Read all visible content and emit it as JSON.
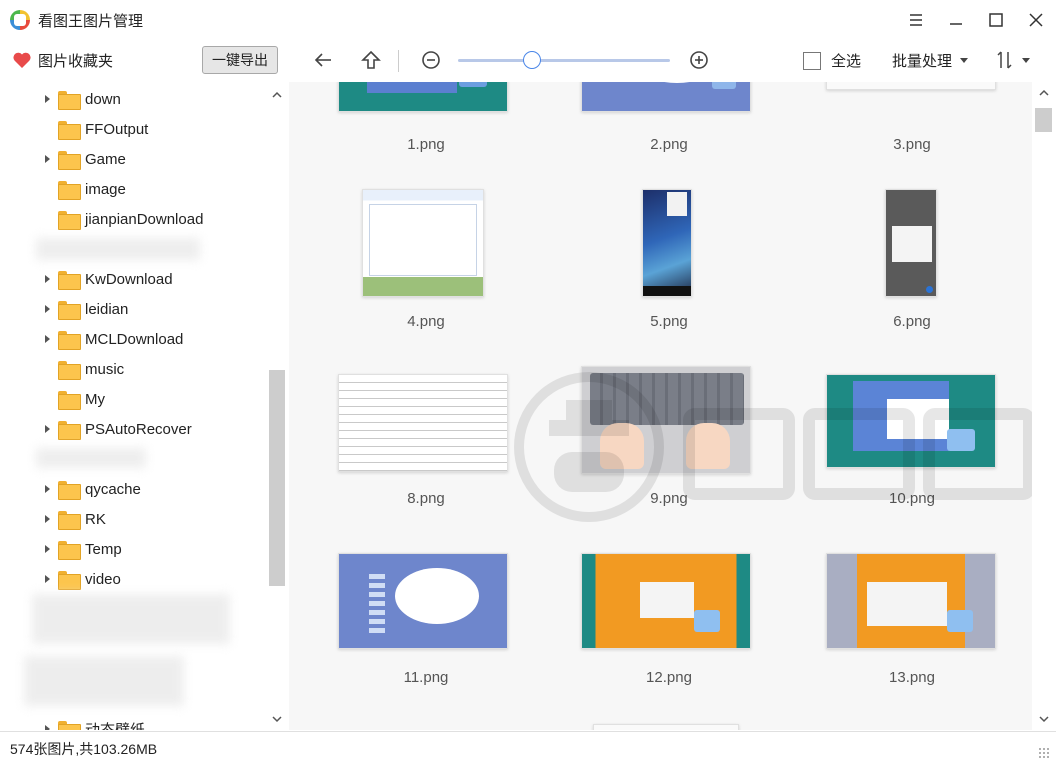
{
  "app": {
    "title": "看图王图片管理",
    "icon": "app-logo-icon"
  },
  "toolbar": {
    "favorites_label": "图片收藏夹",
    "export_label": "一键导出",
    "select_all_label": "全选",
    "batch_label": "批量处理",
    "zoom_level": 0.35
  },
  "sidebar": {
    "folders": [
      {
        "label": "down",
        "expandable": true
      },
      {
        "label": "FFOutput",
        "expandable": false
      },
      {
        "label": "Game",
        "expandable": true
      },
      {
        "label": "image",
        "expandable": false
      },
      {
        "label": "jianpianDownload",
        "expandable": false
      },
      {
        "label": "KwDownload",
        "expandable": true
      },
      {
        "label": "leidian",
        "expandable": true
      },
      {
        "label": "MCLDownload",
        "expandable": true
      },
      {
        "label": "music",
        "expandable": false
      },
      {
        "label": "My",
        "expandable": false
      },
      {
        "label": "PSAutoRecover",
        "expandable": true
      },
      {
        "label": "qycache",
        "expandable": true
      },
      {
        "label": "RK",
        "expandable": true
      },
      {
        "label": "Temp",
        "expandable": true
      },
      {
        "label": "video",
        "expandable": true
      },
      {
        "label": "动态壁纸",
        "expandable": true
      }
    ]
  },
  "images": [
    {
      "name": "1.png"
    },
    {
      "name": "2.png"
    },
    {
      "name": "3.png"
    },
    {
      "name": "4.png"
    },
    {
      "name": "5.png"
    },
    {
      "name": "6.png"
    },
    {
      "name": "8.png"
    },
    {
      "name": "9.png"
    },
    {
      "name": "10.png"
    },
    {
      "name": "11.png"
    },
    {
      "name": "12.png"
    },
    {
      "name": "13.png"
    }
  ],
  "status": {
    "summary": "574张图片,共103.26MB"
  },
  "colors": {
    "accent": "#4a86e8",
    "heart": "#e84a4a",
    "folder": "#fcc54d"
  }
}
